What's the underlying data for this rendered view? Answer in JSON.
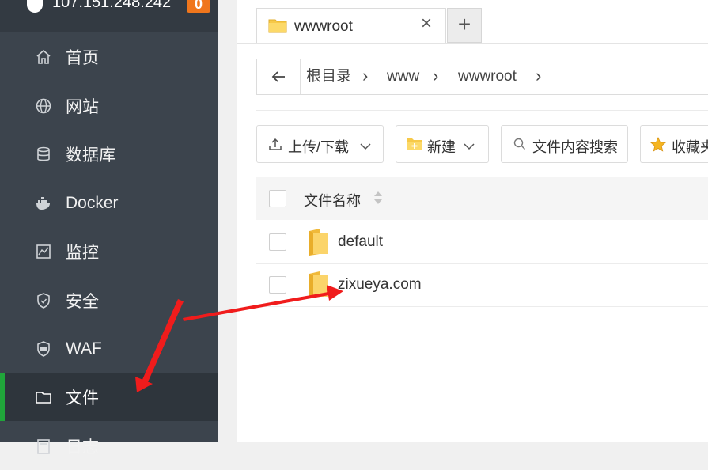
{
  "sidebar": {
    "server_ip": "107.151.248.242",
    "badge": "0",
    "items": [
      {
        "label": "首页",
        "icon": "home-icon"
      },
      {
        "label": "网站",
        "icon": "globe-icon"
      },
      {
        "label": "数据库",
        "icon": "database-icon"
      },
      {
        "label": "Docker",
        "icon": "docker-icon"
      },
      {
        "label": "监控",
        "icon": "monitor-icon"
      },
      {
        "label": "安全",
        "icon": "shield-icon"
      },
      {
        "label": "WAF",
        "icon": "waf-icon"
      },
      {
        "label": "文件",
        "icon": "folder-icon",
        "active": true
      },
      {
        "label": "日志",
        "icon": "log-icon"
      }
    ],
    "active_color": "#20a53a"
  },
  "tabs": [
    {
      "label": "wwwroot",
      "closable": true
    }
  ],
  "path": {
    "crumbs": [
      "根目录",
      "www",
      "wwwroot"
    ]
  },
  "toolbar": {
    "upload_label": "上传/下载",
    "new_label": "新建",
    "search_label": "文件内容搜索",
    "favorites_label": "收藏夹"
  },
  "table": {
    "column_name": "文件名称",
    "rows": [
      {
        "name": "default",
        "type": "folder"
      },
      {
        "name": "zixueya.com",
        "type": "folder"
      }
    ]
  },
  "annotation_color": "#f01c1c"
}
